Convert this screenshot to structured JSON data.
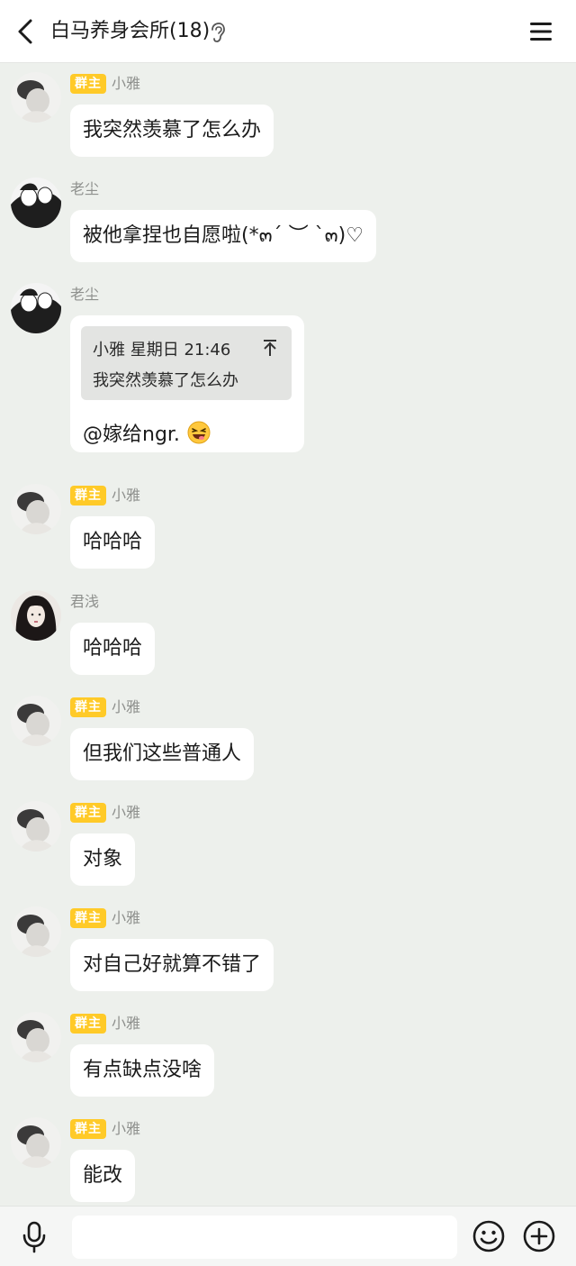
{
  "header": {
    "title": "白马养身会所(18)"
  },
  "messages": [
    {
      "sender": "小雅",
      "badge": "群主",
      "avatar": "light",
      "text": "我突然羡慕了怎么办"
    },
    {
      "sender": "老尘",
      "avatar": "dark",
      "text": "被他拿捏也自愿啦(*๓´ ︶ `๓)♡"
    },
    {
      "sender": "老尘",
      "avatar": "dark",
      "quote": {
        "meta": "小雅 星期日 21:46",
        "text": "我突然羡慕了怎么办"
      },
      "text": "@嫁给ngr."
    },
    {
      "sender": "小雅",
      "badge": "群主",
      "avatar": "light",
      "text": "哈哈哈"
    },
    {
      "sender": "君浅",
      "avatar": "portrait",
      "text": "哈哈哈"
    },
    {
      "sender": "小雅",
      "badge": "群主",
      "avatar": "light",
      "text": "但我们这些普通人"
    },
    {
      "sender": "小雅",
      "badge": "群主",
      "avatar": "light",
      "text": "对象"
    },
    {
      "sender": "小雅",
      "badge": "群主",
      "avatar": "light",
      "text": "对自己好就算不错了"
    },
    {
      "sender": "小雅",
      "badge": "群主",
      "avatar": "light",
      "text": "有点缺点没啥"
    },
    {
      "sender": "小雅",
      "badge": "群主",
      "avatar": "light",
      "text": "能改"
    }
  ],
  "input": {
    "placeholder": ""
  },
  "colors": {
    "badge": "#ffca28",
    "background": "#edf0ec",
    "bubble": "#ffffff"
  },
  "icons": [
    "back-arrow-icon",
    "ear-icon",
    "menu-icon",
    "jump-up-icon",
    "laughing-emoji",
    "mic-icon",
    "smile-icon",
    "plus-icon"
  ]
}
